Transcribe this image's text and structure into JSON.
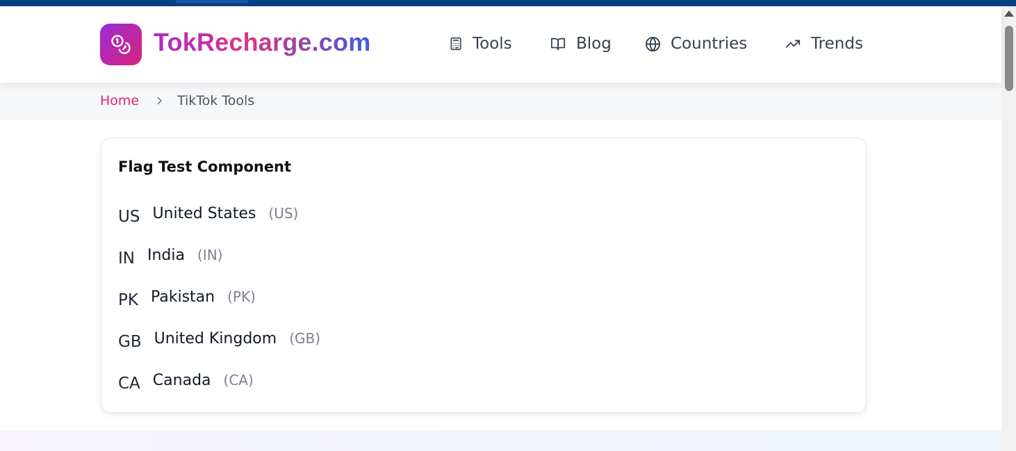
{
  "brand": {
    "name": "TokRecharge.com",
    "logo_icon": "coins-icon"
  },
  "nav": {
    "items": [
      {
        "label": "Tools",
        "icon": "calculator-icon"
      },
      {
        "label": "Blog",
        "icon": "book-open-icon"
      },
      {
        "label": "Countries",
        "icon": "globe-icon"
      },
      {
        "label": "Trends",
        "icon": "trending-up-icon"
      }
    ]
  },
  "breadcrumb": {
    "home": "Home",
    "separator_icon": "chevron-right-icon",
    "current": "TikTok Tools"
  },
  "card": {
    "title": "Flag Test Component",
    "countries": [
      {
        "code": "US",
        "name": "United States",
        "code_paren": "(US)"
      },
      {
        "code": "IN",
        "name": "India",
        "code_paren": "(IN)"
      },
      {
        "code": "PK",
        "name": "Pakistan",
        "code_paren": "(PK)"
      },
      {
        "code": "GB",
        "name": "United Kingdom",
        "code_paren": "(GB)"
      },
      {
        "code": "CA",
        "name": "Canada",
        "code_paren": "(CA)"
      }
    ]
  },
  "colors": {
    "accent_pink": "#db2a68",
    "brand_purple": "#9b2bd6",
    "topbar": "#0a3f86"
  }
}
